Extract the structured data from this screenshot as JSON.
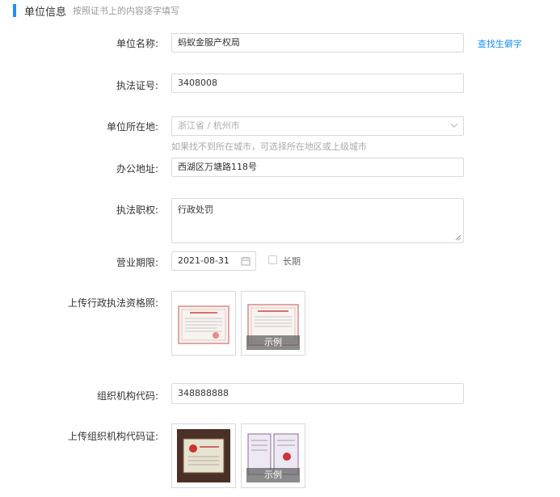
{
  "section": {
    "title": "单位信息",
    "subtitle": "按照证书上的内容逐字填写",
    "accent": "#1890ff"
  },
  "fields": {
    "unit_name": {
      "label": "单位名称:",
      "value": "蚂蚁金服产权局",
      "link": "查找生僻字"
    },
    "license_no": {
      "label": "执法证号:",
      "value": "3408008"
    },
    "location": {
      "label": "单位所在地:",
      "value": "浙江省 / 杭州市",
      "hint": "如果找不到所在城市，可选择所在地区或上级城市"
    },
    "office_address": {
      "label": "办公地址:",
      "value": "西湖区万塘路118号"
    },
    "authority": {
      "label": "执法职权:",
      "value": "行政处罚"
    },
    "business_term": {
      "label": "营业期限:",
      "value": "2021-08-31",
      "long_term_label": "长期"
    },
    "upload_license": {
      "label": "上传行政执法资格照:",
      "example_label": "示例"
    },
    "org_code": {
      "label": "组织机构代码:",
      "value": "348888888"
    },
    "upload_org_cert": {
      "label": "上传组织机构代码证:",
      "example_label": "示例"
    }
  },
  "icons": {
    "chevron": "chevron-down-icon",
    "calendar": "calendar-icon"
  }
}
